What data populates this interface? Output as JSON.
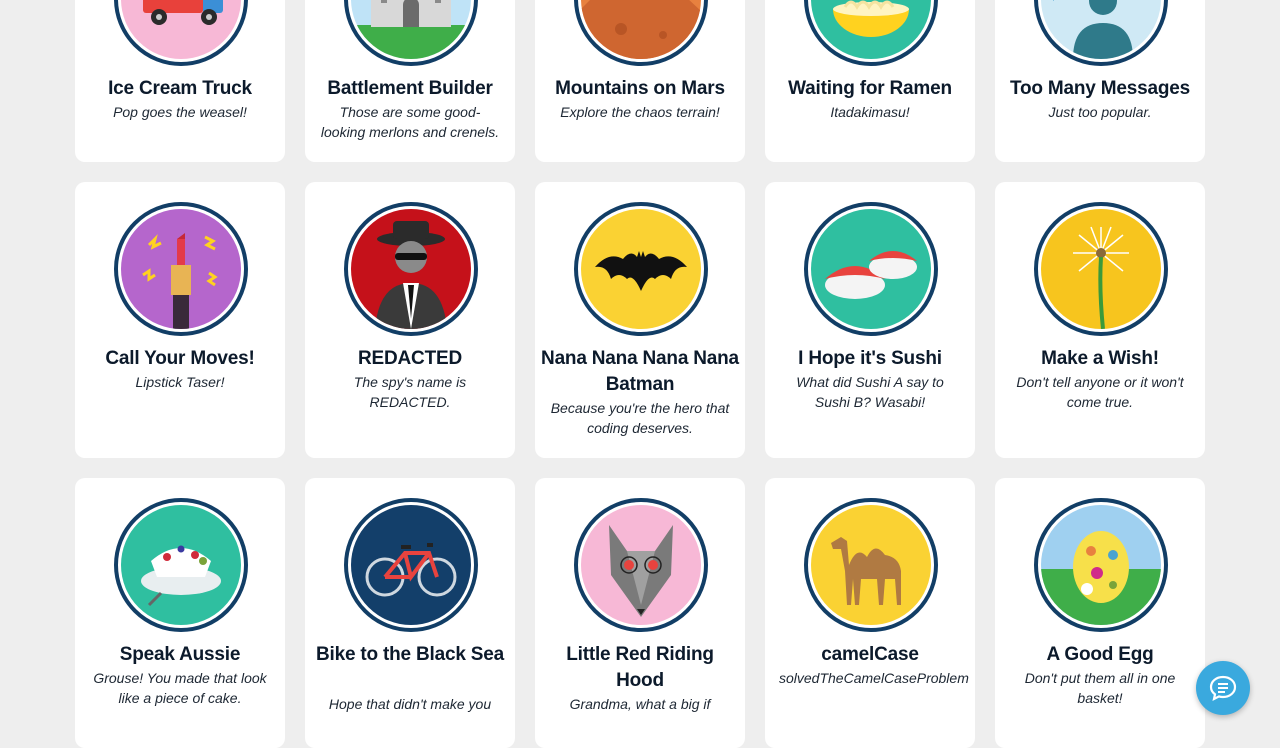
{
  "badges": [
    {
      "title": "Ice Cream Truck",
      "description": "Pop goes the weasel!",
      "icon": "ice-cream-truck-icon"
    },
    {
      "title": "Battlement Builder",
      "description": "Those are some good-looking merlons and crenels.",
      "icon": "castle-icon"
    },
    {
      "title": "Mountains on Mars",
      "description": "Explore the chaos terrain!",
      "icon": "mars-mountains-icon"
    },
    {
      "title": "Waiting for Ramen",
      "description": "Itadakimasu!",
      "icon": "ramen-bowl-icon"
    },
    {
      "title": "Too Many Messages",
      "description": "Just too popular.",
      "icon": "messages-person-icon"
    },
    {
      "title": "Call Your Moves!",
      "description": "Lipstick Taser!",
      "icon": "lipstick-icon"
    },
    {
      "title": "REDACTED",
      "description": "The spy's name is REDACTED.",
      "icon": "spy-icon"
    },
    {
      "title": "Nana Nana Nana Nana Batman",
      "description": "Because you're the hero that coding deserves.",
      "icon": "bat-icon"
    },
    {
      "title": "I Hope it's Sushi",
      "description": "What did Sushi A say to Sushi B? Wasabi!",
      "icon": "sushi-icon"
    },
    {
      "title": "Make a Wish!",
      "description": "Don't tell anyone or it won't come true.",
      "icon": "dandelion-icon"
    },
    {
      "title": "Speak Aussie",
      "description": "Grouse! You made that look like a piece of cake.",
      "icon": "pavlova-cake-icon"
    },
    {
      "title": "Bike to the Black Sea",
      "description": "Hope that didn't make you",
      "icon": "bicycle-icon"
    },
    {
      "title": "Little Red Riding Hood",
      "description": "Grandma, what a big if",
      "icon": "wolf-icon"
    },
    {
      "title": "camelCase",
      "description": "solvedTheCamelCaseProblem",
      "icon": "camel-icon"
    },
    {
      "title": "A Good Egg",
      "description": "Don't put them all in one basket!",
      "icon": "easter-egg-icon"
    }
  ],
  "colors": {
    "background": "#eeeeee",
    "card": "#ffffff",
    "badge_ring": "#123e66",
    "chat_button": "#3aa9de"
  },
  "chat_button": {
    "icon": "chat-bubble-icon"
  }
}
